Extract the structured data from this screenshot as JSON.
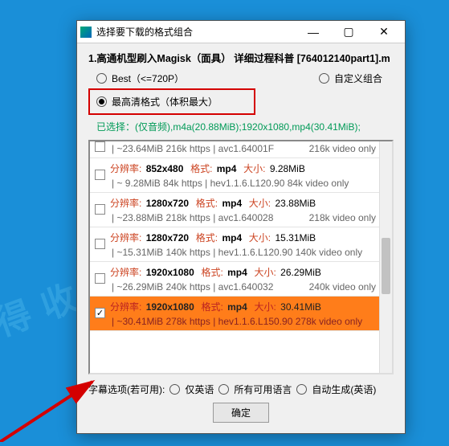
{
  "window": {
    "title": "选择要下载的格式组合"
  },
  "header": {
    "filename": "1.高通机型刷入Magisk（面具） 详细过程科普 [764012140part1].m"
  },
  "radios": {
    "best": {
      "label": "Best（<=720P）"
    },
    "custom": {
      "label": "自定义组合"
    },
    "max": {
      "label": "最高清格式（体积最大）"
    }
  },
  "selected_line": "已选择：(仅音频),m4a(20.88MiB);1920x1080,mp4(30.41MiB);",
  "labels": {
    "res": "分辨率:",
    "fmt": "格式:",
    "size": "大小:"
  },
  "items": [
    {
      "partial": true,
      "res": "",
      "fmt": "",
      "size": "",
      "l2a": "| ~23.64MiB 216k https | avc1.64001F",
      "l2b": "216k video only"
    },
    {
      "res": "852x480",
      "fmt": "mp4",
      "size": "9.28MiB",
      "l2a": "| ~ 9.28MiB  84k https | hev1.1.6.L120.90  84k video only",
      "l2b": ""
    },
    {
      "res": "1280x720",
      "fmt": "mp4",
      "size": "23.88MiB",
      "l2a": "| ~23.88MiB 218k https | avc1.640028",
      "l2b": "218k video only"
    },
    {
      "res": "1280x720",
      "fmt": "mp4",
      "size": "15.31MiB",
      "l2a": "| ~15.31MiB 140k https | hev1.1.6.L120.90 140k video only",
      "l2b": ""
    },
    {
      "res": "1920x1080",
      "fmt": "mp4",
      "size": "26.29MiB",
      "l2a": "| ~26.29MiB 240k https | avc1.640032",
      "l2b": "240k video only"
    },
    {
      "selected": true,
      "res": "1920x1080",
      "fmt": "mp4",
      "size": "30.41MiB",
      "l2a": "| ~30.41MiB 278k https | hev1.1.6.L150.90 278k video only",
      "l2b": ""
    }
  ],
  "subtitle": {
    "label": "字幕选项(若可用):",
    "opt1": "仅英语",
    "opt2": "所有可用语言",
    "opt3": "自动生成(英语)"
  },
  "ok": "确定"
}
